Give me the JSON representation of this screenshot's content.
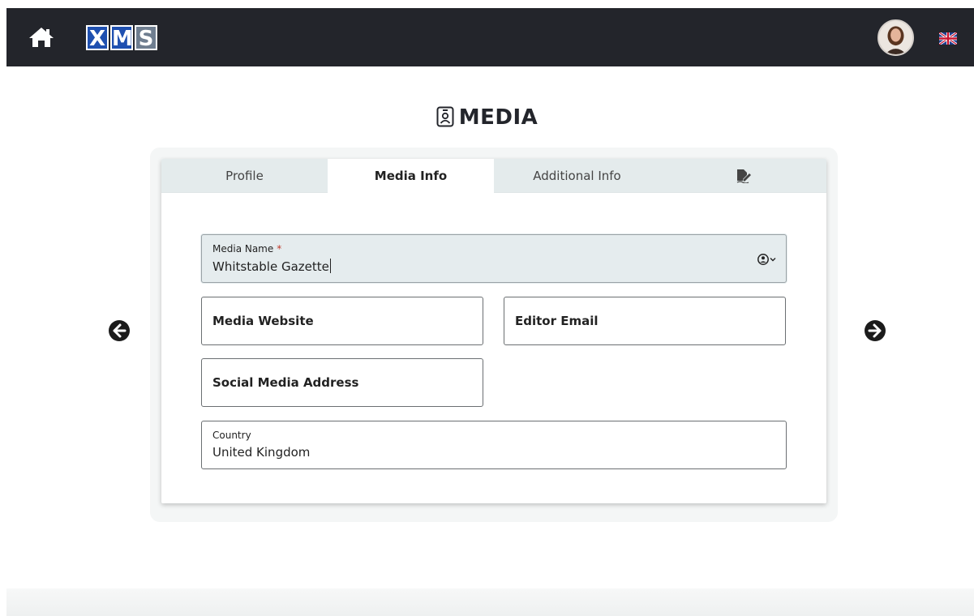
{
  "header": {
    "logo_letters": [
      "X",
      "M",
      "S"
    ],
    "home_icon": "home-icon",
    "avatar_icon": "user-avatar",
    "language_flag": "uk-flag-icon"
  },
  "page": {
    "title": "MEDIA",
    "title_icon": "id-badge-icon"
  },
  "tabs": [
    {
      "label": "Profile",
      "active": false
    },
    {
      "label": "Media Info",
      "active": true
    },
    {
      "label": "Additional Info",
      "active": false
    },
    {
      "icon": "signature-icon",
      "active": false
    }
  ],
  "form": {
    "media_name": {
      "label": "Media Name",
      "required_marker": "*",
      "value": "Whitstable Gazette"
    },
    "media_website": {
      "label": "Media Website"
    },
    "editor_email": {
      "label": "Editor Email"
    },
    "social_media_address": {
      "label": "Social Media Address"
    },
    "country": {
      "label": "Country",
      "value": "United Kingdom"
    }
  },
  "navigation": {
    "prev_icon": "arrow-left-circle-icon",
    "next_icon": "arrow-right-circle-icon"
  },
  "colors": {
    "topbar": "#23252b",
    "logo_blue": "#1f50b0",
    "logo_gray": "#6f7e90",
    "tab_bg": "#e4ebec",
    "focused_field_bg": "#e5ecee",
    "required": "#c0392b"
  }
}
